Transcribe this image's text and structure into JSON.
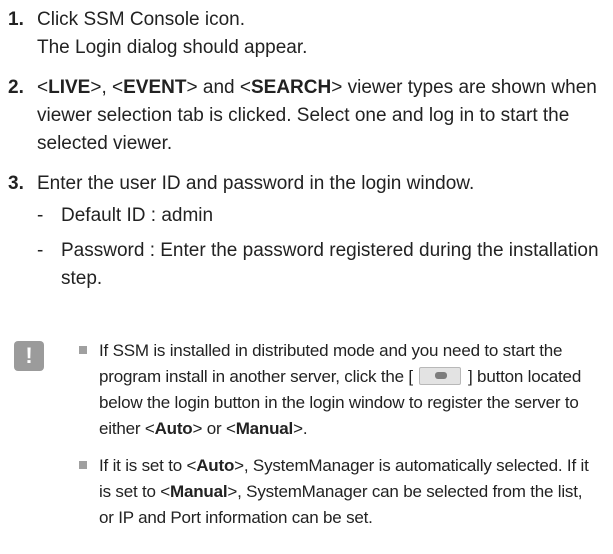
{
  "steps": [
    {
      "num": "1.",
      "line1": "Click SSM Console icon.",
      "line2": "The Login dialog should appear."
    },
    {
      "num": "2.",
      "lt": "<",
      "gt": ">",
      "live": "LIVE",
      "sep1": ", ",
      "event": "EVENT",
      "sep2": " and ",
      "search": "SEARCH",
      "rest": " viewer types are shown when viewer selection tab is clicked. Select one and log in to start the selected viewer."
    },
    {
      "num": "3.",
      "text": "Enter the user ID and password in the login window.",
      "dash": "-",
      "subs": [
        {
          "text": "Default ID : admin"
        },
        {
          "text": "Password : Enter the password registered during the installation step."
        }
      ]
    }
  ],
  "note": {
    "icon": "!",
    "icon_name": "exclamation-icon",
    "bullet1": {
      "before": "If SSM is installed in distributed mode and you need to start the program install in another server, click the [",
      "button_icon": "server-settings-icon",
      "after": "] button located below the login button in the login window to register the server to either <",
      "auto": "Auto",
      "mid": "> or <",
      "manual": "Manual",
      "end": ">."
    },
    "bullet2": {
      "p1": "If it is set to <",
      "auto": "Auto",
      "p2": ">, SystemManager is automatically selected. If it is set to <",
      "manual": "Manual",
      "p3": ">, SystemManager can be selected from the list, or IP and Port information can be set."
    }
  }
}
